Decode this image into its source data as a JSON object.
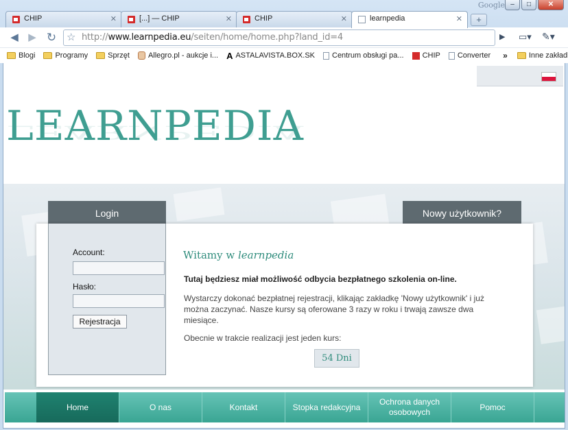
{
  "browser": {
    "brand": "Google",
    "tabs": [
      {
        "title": "CHIP"
      },
      {
        "title": "[...] — CHIP"
      },
      {
        "title": "CHIP"
      },
      {
        "title": "learnpedia"
      }
    ],
    "new_tab": "+",
    "address": {
      "prefix": "http://",
      "domain": "www.learnpedia.eu",
      "path": "/seiten/home/home.php?land_id=4"
    },
    "bookmarks": [
      {
        "label": "Blogi",
        "icon": "folder-icon"
      },
      {
        "label": "Programy",
        "icon": "folder-icon"
      },
      {
        "label": "Sprzęt",
        "icon": "folder-icon"
      },
      {
        "label": "Allegro.pl - aukcje i...",
        "icon": "allegro-icon"
      },
      {
        "label": "ASTALAVISTA.BOX.SK",
        "icon": "astalavista-icon"
      },
      {
        "label": "Centrum obsługi pa...",
        "icon": "page-icon"
      },
      {
        "label": "CHIP",
        "icon": "chip-icon"
      },
      {
        "label": "Converter",
        "icon": "page-icon"
      }
    ],
    "bookmarks_more": "»",
    "other_bookmarks": "Inne zakładki"
  },
  "page": {
    "logo": "LEARNPEDIA",
    "login_tab": "Login",
    "new_user_tab": "Nowy użytkownik?",
    "login": {
      "account_label": "Account:",
      "password_label": "Hasło:",
      "register_button": "Rejestracja"
    },
    "welcome": {
      "title_prefix": "Witamy w ",
      "title_brand": "learnpedia",
      "lead": "Tutaj będziesz miał możliwość odbycia bezpłatnego szkolenia on-line.",
      "text": "Wystarczy dokonać bezpłatnej rejestracji, klikając zakładkę 'Nowy użytkownik' i już można zaczynać. Nasze kursy są oferowane 3 razy w roku i trwają zawsze dwa miesiące.",
      "current": "Obecnie w trakcie realizacji jest jeden kurs:",
      "days": "54 Dni"
    },
    "nav": [
      "Home",
      "O nas",
      "Kontakt",
      "Stopka redakcyjna",
      "Ochrona danych osobowych",
      "Pomoc"
    ]
  }
}
